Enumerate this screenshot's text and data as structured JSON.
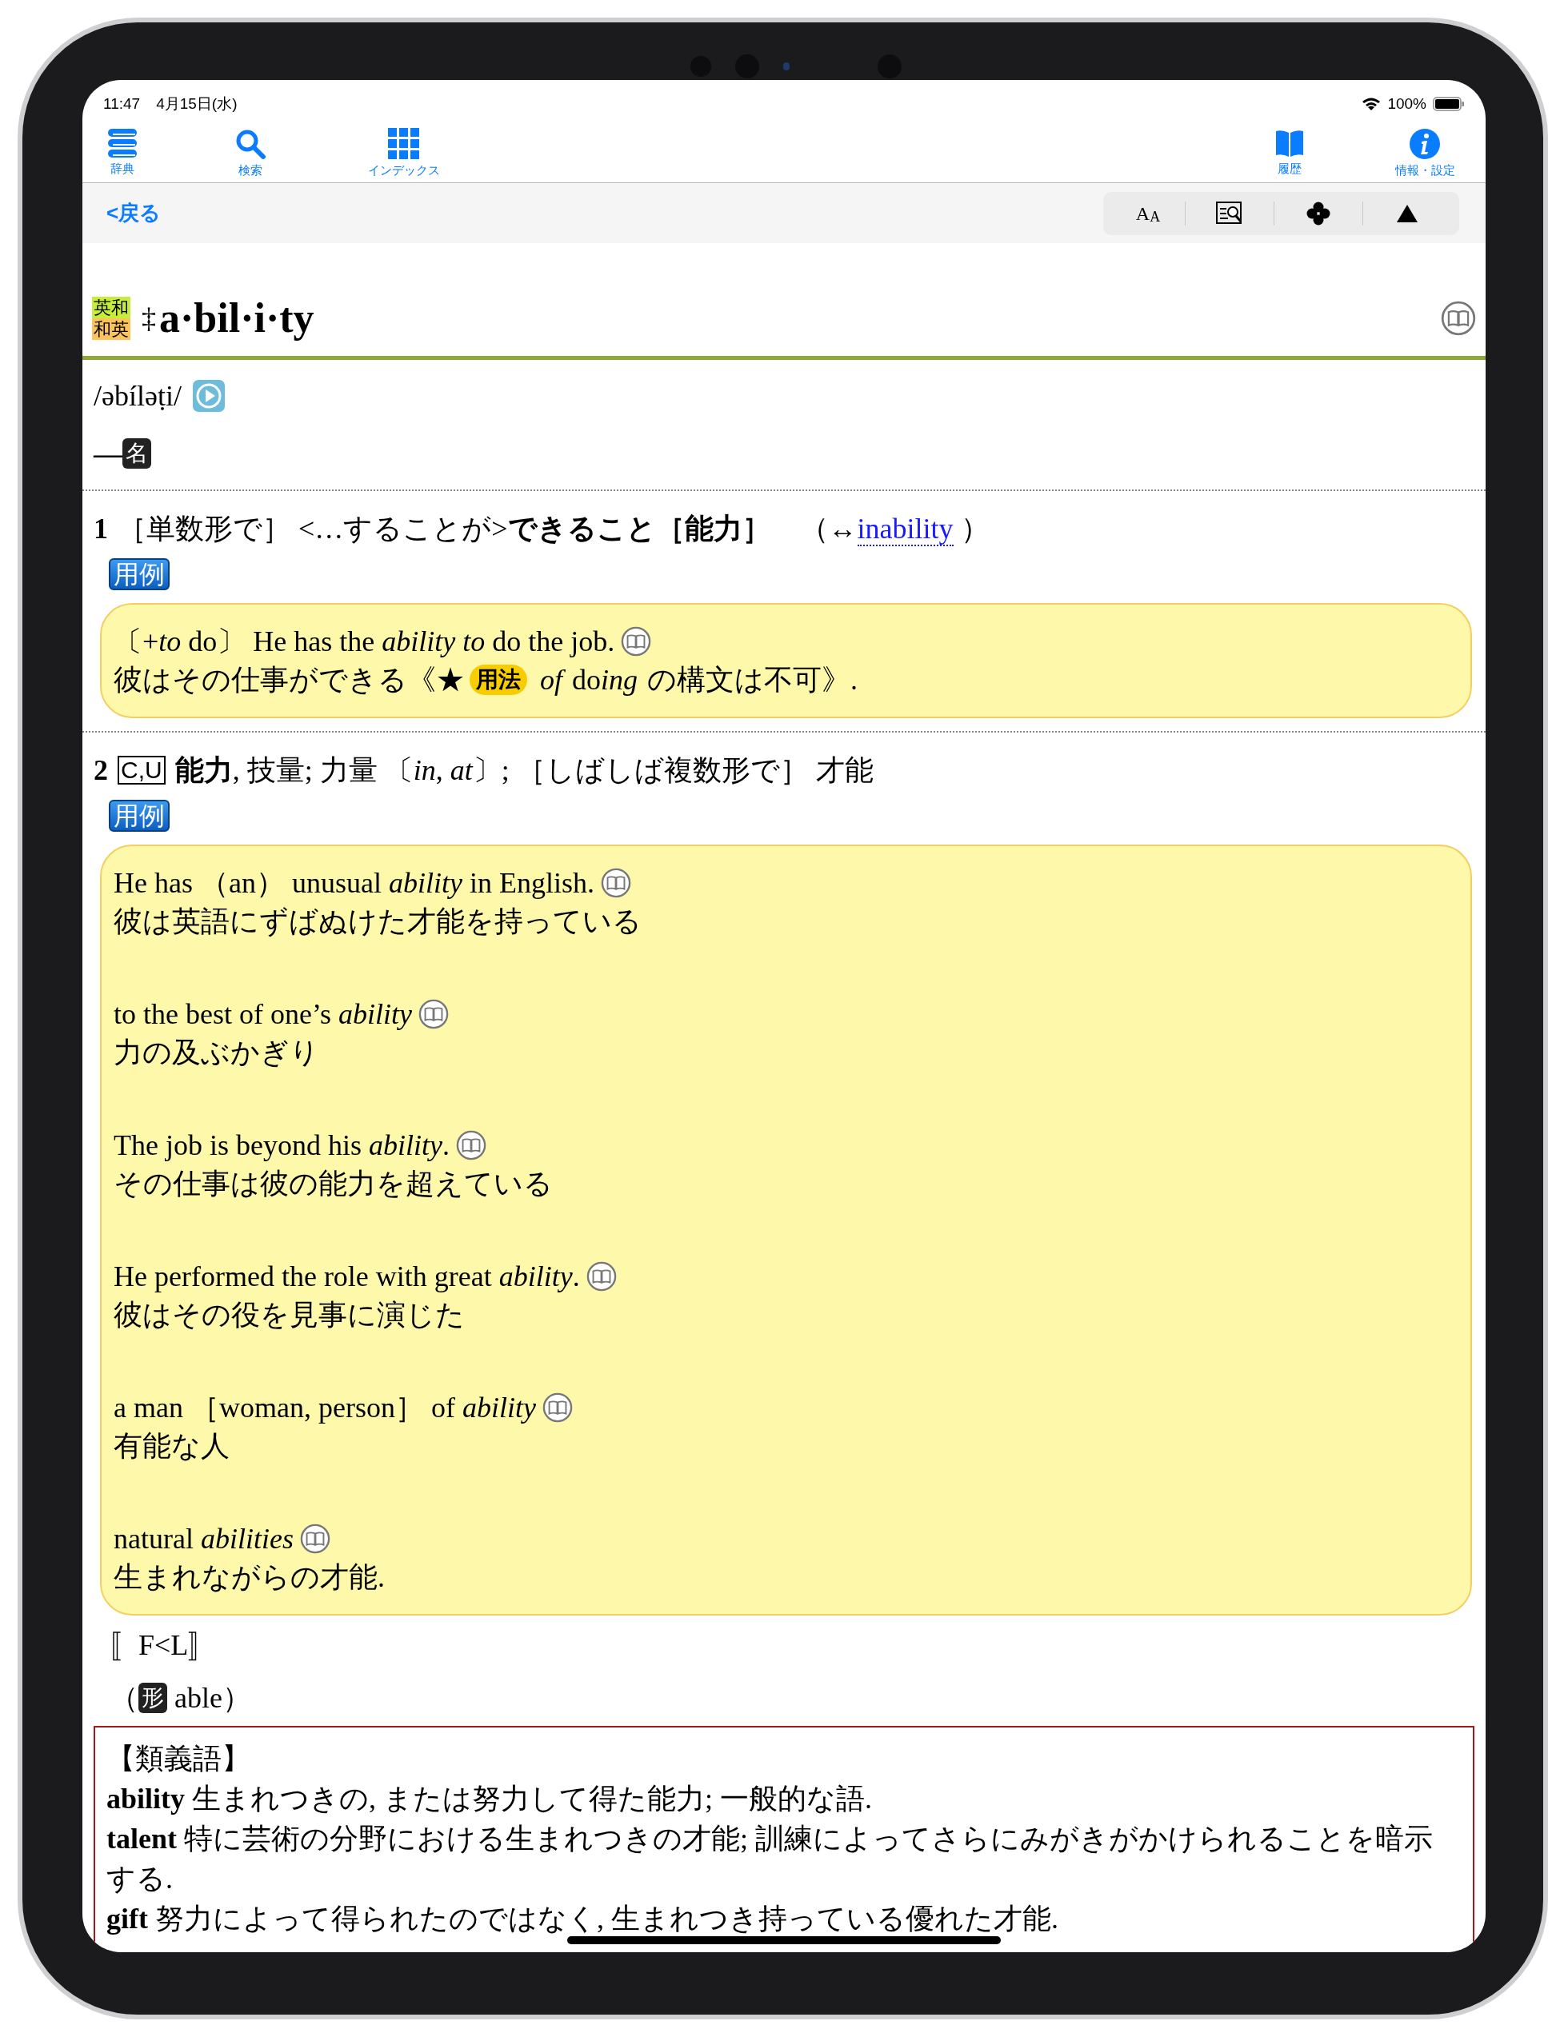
{
  "status_bar": {
    "time": "11:47",
    "date": "4月15日(水)",
    "battery": "100%"
  },
  "toolbar": {
    "left": [
      {
        "label": "辞典"
      },
      {
        "label": "検索"
      },
      {
        "label": "インデックス"
      }
    ],
    "right": [
      {
        "label": "履歴"
      },
      {
        "label": "情報・設定"
      }
    ]
  },
  "nav": {
    "back": "<戻る",
    "font_button": "A$_{A}$"
  },
  "entry": {
    "badges": [
      "英和",
      "和英"
    ],
    "mark": "‡",
    "headword": "a·bil·i·ty",
    "pronunciation": "/əbíləṭi/",
    "pos_dash": "—",
    "pos": "名",
    "senses": [
      {
        "number": "1",
        "definition": "［単数形で］ <…することが>**できること［能力］**　（↔",
        "link": "inability",
        "after_link": " ）",
        "example_label": "用例",
        "examples": [
          {
            "en": "〔+*to* do〕 He has the *ability to* do the job.",
            "ja": "彼はその仕事ができる《★",
            "note": {
              "badge": "用法",
              "after": [
                {
                  "text": "of",
                  "italic": true
                },
                {
                  "text": " do"
                },
                {
                  "text": "ing",
                  "italic": true
                },
                {
                  "text": " の構文は不可》."
                }
              ]
            }
          }
        ]
      },
      {
        "number": "2",
        "grammar": "C,U",
        "definition": "**能力**, 技量; 力量 〔*in*, *at*〕; ［しばしば複数形で］ 才能",
        "example_label": "用例",
        "examples": [
          {
            "en": "He has （an） unusual *ability* in English.",
            "ja": "彼は英語にずばぬけた才能を持っている"
          },
          {
            "en": "to the best of one’s *ability*",
            "ja": "力の及ぶかぎり"
          },
          {
            "en": "The job is beyond his *ability*.",
            "ja": "その仕事は彼の能力を超えている"
          },
          {
            "en": "He performed the role with great *ability*.",
            "ja": "彼はその役を見事に演じた"
          },
          {
            "en": "a man ［woman, person］ of *ability*",
            "ja": "有能な人"
          },
          {
            "en": "natural *abilities*",
            "ja": "生まれながらの才能."
          }
        ]
      }
    ],
    "etymology": "〚F<L〛",
    "related": {
      "open": "（",
      "pos": "形",
      "word": " able）"
    },
    "synonyms": {
      "heading": "【類義語】",
      "items": [
        {
          "term": "ability",
          "text": "生まれつきの, または努力して得た能力; 一般的な語."
        },
        {
          "term": "talent",
          "text": "特に芸術の分野における生まれつきの才能; 訓練によってさらにみがきがかけられることを暗示する."
        },
        {
          "term": "gift",
          "text": "努力によって得られたのではなく, 生まれつき持っている優れた才能."
        }
      ]
    }
  }
}
